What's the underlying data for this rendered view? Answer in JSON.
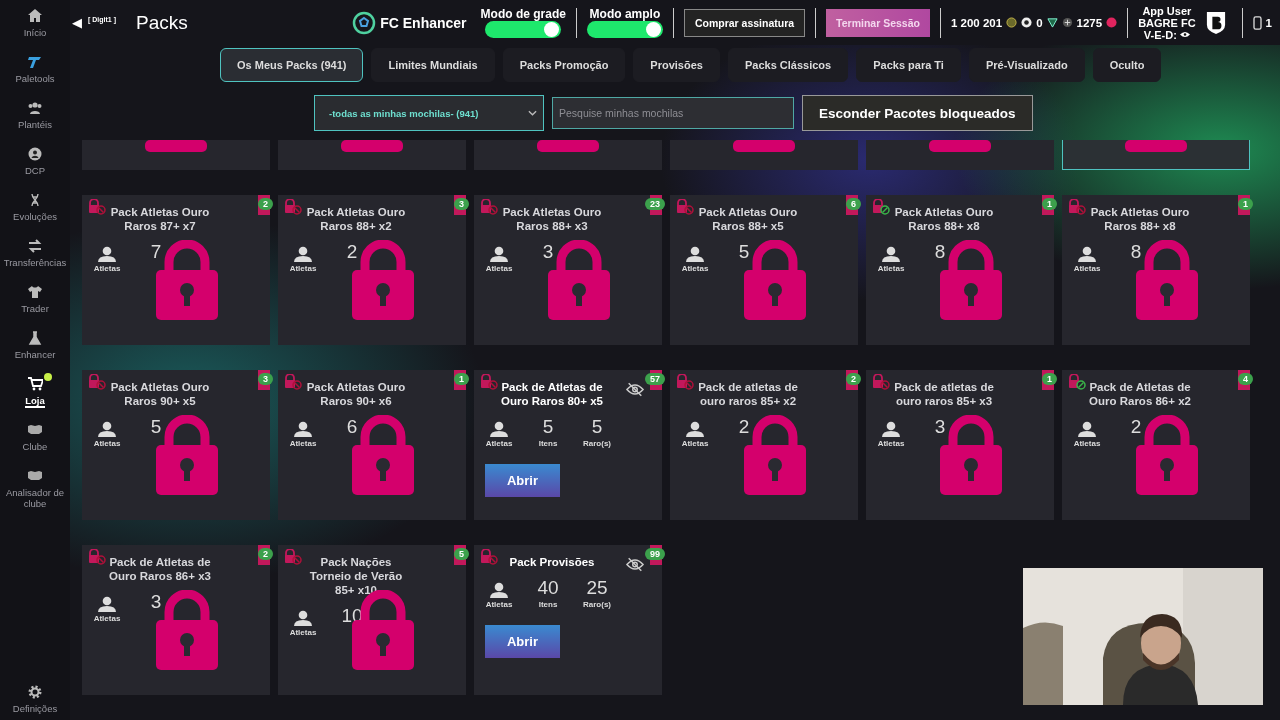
{
  "sidebar": {
    "items": [
      {
        "label": "Início",
        "selected": false,
        "notification": false
      },
      {
        "label": "Paletools",
        "selected": false,
        "notification": false
      },
      {
        "label": "Plantéis",
        "selected": false,
        "notification": false
      },
      {
        "label": "DCP",
        "selected": false,
        "notification": false
      },
      {
        "label": "Evoluções",
        "selected": false,
        "notification": false
      },
      {
        "label": "Transferências",
        "selected": false,
        "notification": false
      },
      {
        "label": "Trader",
        "selected": false,
        "notification": false
      },
      {
        "label": "Enhancer",
        "selected": false,
        "notification": false
      },
      {
        "label": "Loja",
        "selected": true,
        "notification": true
      },
      {
        "label": "Clube",
        "selected": false,
        "notification": false
      },
      {
        "label": "Analisador de clube",
        "selected": false,
        "notification": false
      }
    ],
    "footer": {
      "label": "Definições"
    }
  },
  "header": {
    "back": "◀",
    "shortcut": "[ Digit1 ]",
    "title": "Packs",
    "brand": "FC Enhancer",
    "toggles": [
      {
        "label": "Modo de grade",
        "on": true
      },
      {
        "label": "Modo amplo",
        "on": true
      }
    ],
    "buttons": [
      {
        "label": "Comprar assinatura",
        "kind": "outline"
      },
      {
        "label": "Terminar Sessão",
        "kind": "accent"
      }
    ],
    "coins": "1 200 201",
    "tokens": "0",
    "points": "1275",
    "user": {
      "name": "App User",
      "club": "BAGRE FC",
      "record": "V-E-D:"
    },
    "devices": "1"
  },
  "tabs": [
    {
      "label": "Os Meus Packs (941)",
      "selected": true
    },
    {
      "label": "Limites Mundiais",
      "selected": false
    },
    {
      "label": "Packs Promoção",
      "selected": false
    },
    {
      "label": "Provisões",
      "selected": false
    },
    {
      "label": "Packs Clássicos",
      "selected": false
    },
    {
      "label": "Packs para Ti",
      "selected": false
    },
    {
      "label": "Pré-Visualizado",
      "selected": false
    },
    {
      "label": "Oculto",
      "selected": false
    }
  ],
  "filters": {
    "select": "-todas as minhas mochilas- (941)",
    "search": {
      "placeholder": "Pesquise minhas mochilas"
    },
    "button": "Esconder Pacotes bloqueados"
  },
  "partial_cards": [
    {
      "highlighted": false
    },
    {
      "highlighted": false
    },
    {
      "highlighted": false
    },
    {
      "highlighted": false
    },
    {
      "highlighted": false
    },
    {
      "highlighted": true
    }
  ],
  "rows": [
    [
      {
        "title": "Pack Atletas Ouro Raros 87+ x7",
        "count": "2",
        "allowed": false,
        "locked": true,
        "hidden": false,
        "labels": [
          "Atletas"
        ],
        "itens": "7"
      },
      {
        "title": "Pack Atletas Ouro Raros 88+ x2",
        "count": "3",
        "allowed": false,
        "locked": true,
        "hidden": false,
        "labels": [
          "Atletas"
        ],
        "itens": "2"
      },
      {
        "title": "Pack Atletas Ouro Raros 88+ x3",
        "count": "23",
        "allowed": false,
        "locked": true,
        "hidden": false,
        "labels": [
          "Atletas"
        ],
        "itens": "3"
      },
      {
        "title": "Pack Atletas Ouro Raros 88+ x5",
        "count": "6",
        "allowed": false,
        "locked": true,
        "hidden": false,
        "labels": [
          "Atletas"
        ],
        "itens": "5"
      },
      {
        "title": "Pack Atletas Ouro Raros 88+ x8",
        "count": "1",
        "allowed": true,
        "locked": true,
        "hidden": false,
        "labels": [
          "Atletas"
        ],
        "itens": "8"
      },
      {
        "title": "Pack Atletas Ouro Raros 88+ x8",
        "count": "1",
        "allowed": false,
        "locked": true,
        "hidden": false,
        "labels": [
          "Atletas"
        ],
        "itens": "8"
      }
    ],
    [
      {
        "title": "Pack Atletas Ouro Raros 90+ x5",
        "count": "3",
        "allowed": false,
        "locked": true,
        "hidden": false,
        "labels": [
          "Atletas"
        ],
        "itens": "5"
      },
      {
        "title": "Pack Atletas Ouro Raros 90+ x6",
        "count": "1",
        "allowed": false,
        "locked": true,
        "hidden": false,
        "labels": [
          "Atletas"
        ],
        "itens": "6"
      },
      {
        "title": "Pack de Atletas de Ouro Raros 80+ x5",
        "count": "57",
        "allowed": false,
        "locked": false,
        "hidden": true,
        "labels": [
          "Atletas",
          "Itens",
          "Raro(s)"
        ],
        "itens": "5",
        "raros": "5",
        "action": "Abrir"
      },
      {
        "title": "Pack de atletas de ouro raros 85+ x2",
        "count": "2",
        "allowed": false,
        "locked": true,
        "hidden": false,
        "labels": [
          "Atletas"
        ],
        "itens": "2"
      },
      {
        "title": "Pack de atletas de ouro raros 85+ x3",
        "count": "1",
        "allowed": false,
        "locked": true,
        "hidden": false,
        "labels": [
          "Atletas"
        ],
        "itens": "3"
      },
      {
        "title": "Pack de Atletas de Ouro Raros 86+ x2",
        "count": "4",
        "allowed": true,
        "locked": true,
        "hidden": false,
        "labels": [
          "Atletas"
        ],
        "itens": "2"
      }
    ],
    [
      {
        "title": "Pack de Atletas de Ouro Raros 86+ x3",
        "count": "2",
        "allowed": false,
        "locked": true,
        "hidden": false,
        "labels": [
          "Atletas"
        ],
        "itens": "3"
      },
      {
        "title": "Pack Nações Torneio de Verão 85+ x10",
        "count": "5",
        "allowed": false,
        "locked": true,
        "hidden": false,
        "labels": [
          "Atletas"
        ],
        "itens": "10"
      },
      {
        "title": "Pack Provisões",
        "count": "99",
        "allowed": false,
        "locked": false,
        "hidden": true,
        "labels": [
          "Atletas",
          "Itens",
          "Raro(s)"
        ],
        "itens": "40",
        "raros": "25",
        "action": "Abrir"
      }
    ]
  ]
}
